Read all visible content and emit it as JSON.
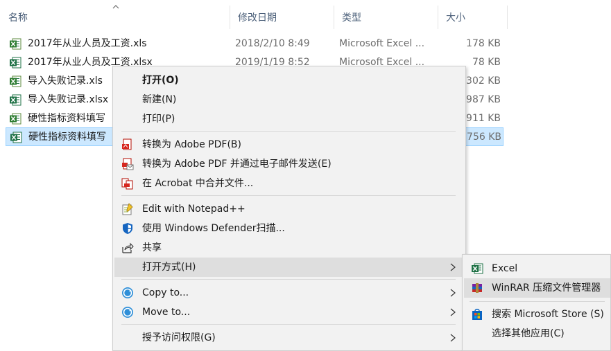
{
  "columns": {
    "name": "名称",
    "date": "修改日期",
    "type": "类型",
    "size": "大小"
  },
  "files": [
    {
      "name": "2017年从业人员及工资.xls",
      "date": "2018/2/10 8:49",
      "type": "Microsoft Excel ...",
      "size": "178 KB",
      "icon": "excel-xls-icon",
      "selected": false
    },
    {
      "name": "2017年从业人员及工资.xlsx",
      "date": "2019/1/19 8:52",
      "type": "Microsoft Excel ...",
      "size": "78 KB",
      "icon": "excel-xlsx-icon",
      "selected": false
    },
    {
      "name": "导入失败记录.xls",
      "date": "",
      "type": "",
      "size": "302 KB",
      "icon": "excel-xls-icon",
      "selected": false
    },
    {
      "name": "导入失败记录.xlsx",
      "date": "",
      "type": "",
      "size": "987 KB",
      "icon": "excel-xlsx-icon",
      "selected": false
    },
    {
      "name": "硬性指标资料填写",
      "date": "",
      "type": "",
      "size": "911 KB",
      "icon": "excel-xls-icon",
      "selected": false
    },
    {
      "name": "硬性指标资料填写",
      "date": "",
      "type": "",
      "size": "756 KB",
      "icon": "excel-xlsx-icon",
      "selected": true
    }
  ],
  "context_menu": {
    "open": "打开(O)",
    "new": "新建(N)",
    "print": "打印(P)",
    "convert_pdf": "转换为 Adobe PDF(B)",
    "convert_pdf_email": "转换为 Adobe PDF 并通过电子邮件发送(E)",
    "acrobat_merge": "在 Acrobat 中合并文件...",
    "notepad": "Edit with Notepad++",
    "defender": "使用 Windows Defender扫描...",
    "share": "共享",
    "open_with": "打开方式(H)",
    "copy_to": "Copy to...",
    "move_to": "Move to...",
    "grant_access": "授予访问权限(G)"
  },
  "open_with_submenu": {
    "excel": "Excel",
    "winrar": "WinRAR 压缩文件管理器",
    "store": "搜索 Microsoft Store (S)",
    "other": "选择其他应用(C)"
  },
  "colors": {
    "selection": "#cce8ff",
    "menu_bg": "#f2f2f2",
    "menu_hover": "#dedede",
    "excel_green": "#1e7145"
  }
}
